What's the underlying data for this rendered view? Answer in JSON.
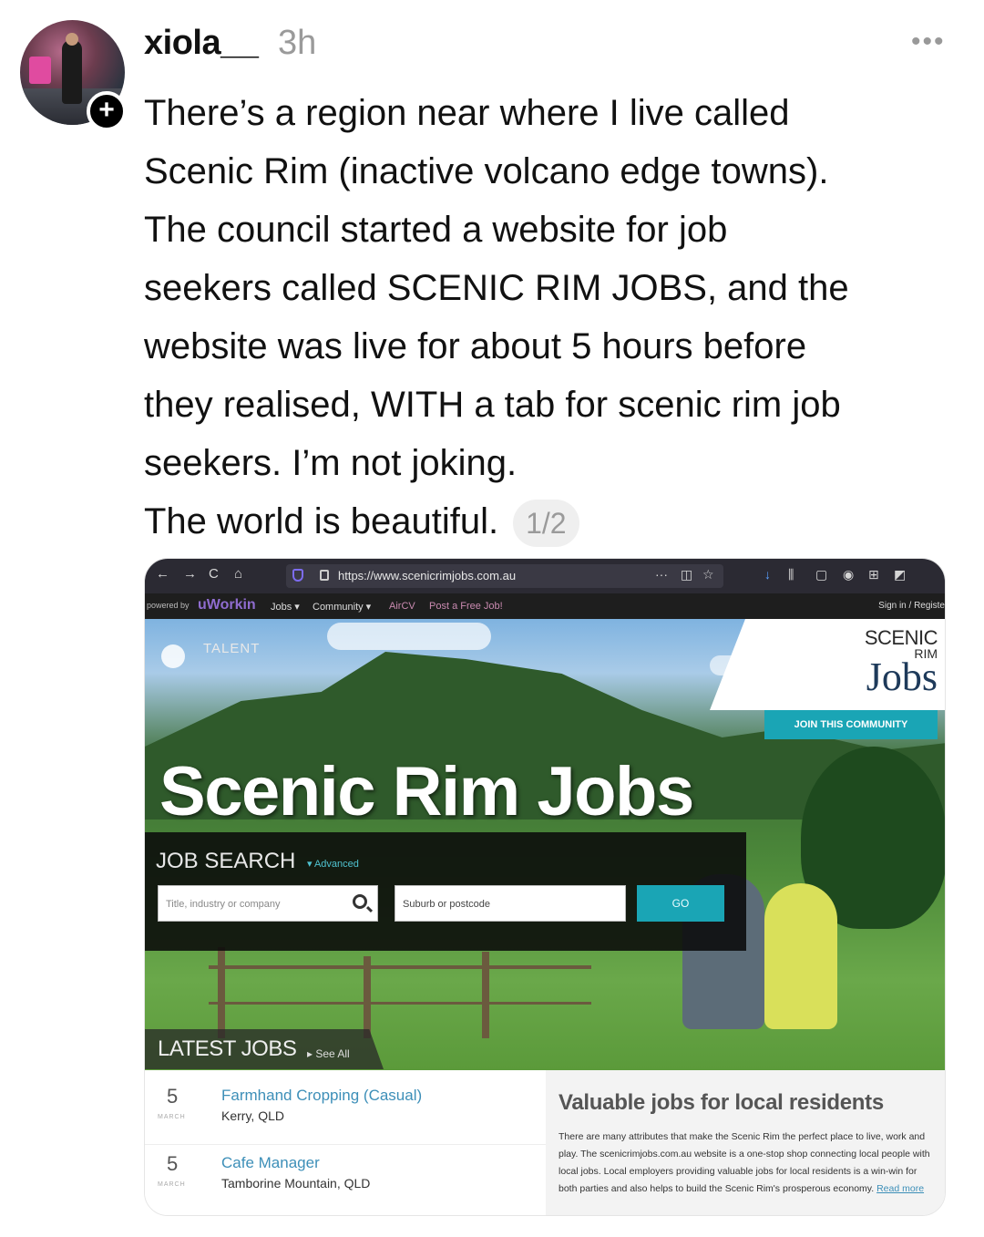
{
  "post": {
    "username": "xiola__",
    "timestamp": "3h",
    "more_icon": "more-dots-icon",
    "follow_icon": "plus-icon",
    "text_lines": [
      "There’s a region near where I live called",
      "Scenic Rim (inactive volcano edge towns).",
      "The council started a website for job",
      "seekers called SCENIC RIM JOBS, and the",
      "website was live for about 5 hours before",
      "they realised, WITH a tab for scenic rim job",
      "seekers. I’m not joking.",
      "The world is beautiful."
    ],
    "page_indicator": "1/2"
  },
  "screenshot": {
    "browser": {
      "url": "https://www.scenicrimjobs.com.au",
      "icons": [
        "back-icon",
        "forward-icon",
        "reload-icon",
        "home-icon",
        "shield-icon",
        "lock-icon",
        "more-dots-icon",
        "pocket-icon",
        "star-icon",
        "download-icon",
        "library-icon",
        "sidebar-icon",
        "account-icon",
        "extension-icon",
        "screenshot-icon"
      ]
    },
    "site_nav": {
      "powered_by": "powered by",
      "brand": "uWorkin",
      "items": [
        "Jobs ▾",
        "Community ▾",
        "AirCV",
        "Post a Free Job!"
      ],
      "sign_in": "Sign in / Registe"
    },
    "hero": {
      "talent_label": "TALENT",
      "logo_scenic": "SCENIC",
      "logo_rim": "RIM",
      "logo_jobs": "Jobs",
      "join_button": "JOIN THIS COMMUNITY",
      "title": "Scenic Rim Jobs"
    },
    "search": {
      "title": "JOB SEARCH",
      "advanced": "▾ Advanced",
      "keyword_placeholder": "Title, industry or company",
      "location_value": "Suburb or postcode",
      "go_button": "GO"
    },
    "latest": {
      "title": "LATEST JOBS",
      "see_all": "▸ See All",
      "jobs": [
        {
          "day": "5",
          "month": "MARCH",
          "title": "Farmhand Cropping (Casual)",
          "location": "Kerry, QLD"
        },
        {
          "day": "5",
          "month": "MARCH",
          "title": "Cafe Manager",
          "location": "Tamborine Mountain, QLD"
        }
      ]
    },
    "info": {
      "heading": "Valuable jobs for local residents",
      "body": "There are many attributes that make the Scenic Rim the perfect place to live, work and play. The scenicrimjobs.com.au website is a one-stop shop connecting local people with local jobs. Local employers providing valuable jobs for local residents is a win-win for both parties and also helps to build the Scenic Rim's prosperous economy.",
      "read_more": "Read more"
    },
    "colors": {
      "accent": "#1aa5b5",
      "brand_purple": "#8f6ccf",
      "job_link": "#3d8fb8"
    }
  }
}
